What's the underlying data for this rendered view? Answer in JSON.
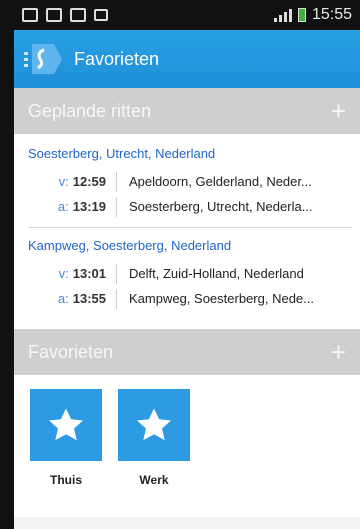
{
  "statusbar": {
    "time": "15:55"
  },
  "appbar": {
    "title": "Favorieten"
  },
  "planned": {
    "header": "Geplande ritten",
    "trips": [
      {
        "title": "Soesterberg, Utrecht, Nederland",
        "legs": [
          {
            "label": "v:",
            "time": "12:59",
            "dest": "Apeldoorn, Gelderland, Neder..."
          },
          {
            "label": "a:",
            "time": "13:19",
            "dest": "Soesterberg, Utrecht, Nederla..."
          }
        ]
      },
      {
        "title": "Kampweg, Soesterberg, Nederland",
        "legs": [
          {
            "label": "v:",
            "time": "13:01",
            "dest": "Delft, Zuid-Holland, Nederland"
          },
          {
            "label": "a:",
            "time": "13:55",
            "dest": "Kampweg, Soesterberg, Nede..."
          }
        ]
      }
    ]
  },
  "favorites": {
    "header": "Favorieten",
    "items": [
      {
        "label": "Thuis",
        "icon": "star-icon"
      },
      {
        "label": "Werk",
        "icon": "star-icon"
      }
    ]
  },
  "colors": {
    "accent": "#1e8fd8",
    "link": "#1f66c6",
    "tile": "#2d9be3",
    "section": "#cfcfcf"
  }
}
